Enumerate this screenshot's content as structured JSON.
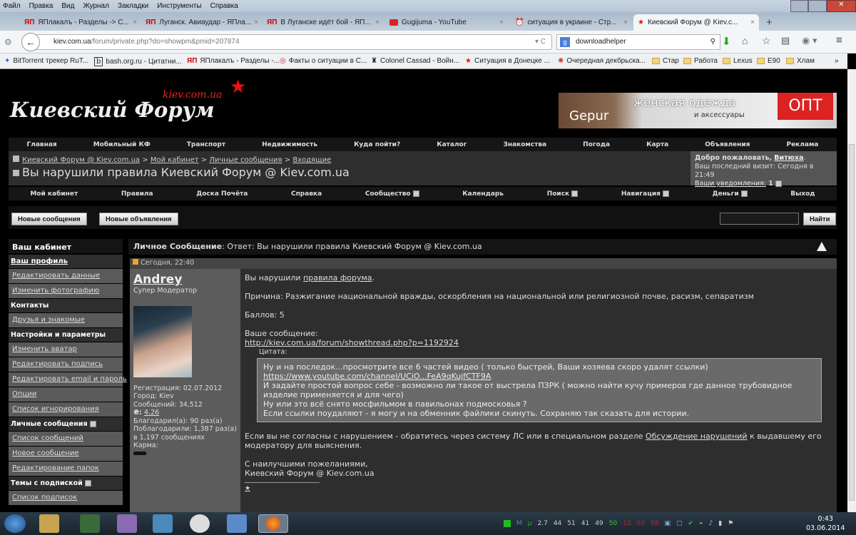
{
  "browser": {
    "menu": [
      "Файл",
      "Правка",
      "Вид",
      "Журнал",
      "Закладки",
      "Инструменты",
      "Справка"
    ],
    "tabs": [
      {
        "label": "ЯПлакалъ - Разделы -> С...",
        "icon": "yaplakal-icon"
      },
      {
        "label": "Луганск. Авиаудар - ЯПла...",
        "icon": "yaplakal-icon"
      },
      {
        "label": "В Луганске идёт бой - ЯП...",
        "icon": "yaplakal-icon"
      },
      {
        "label": "Gugijuma - YouTube",
        "icon": "youtube-icon"
      },
      {
        "label": "ситуация в украине - Стр...",
        "icon": "alarm-icon"
      },
      {
        "label": "Киевский Форум @ Kiev.c...",
        "icon": "star-icon",
        "active": true
      }
    ],
    "url_host": "kiev.com.ua",
    "url_path": "/forum/private.php?do=showpm&pmid=207874",
    "search_value": "downloadhelper",
    "bookmarks": [
      "BitTorrent трекер RuT...",
      "bash.org.ru - Цитатни...",
      "ЯПлакалъ - Разделы -...",
      "Факты о ситуации в С...",
      "Colonel Cassad - Войн...",
      "Ситуация в Донецке ...",
      "Очередная декбрьска..."
    ],
    "bookmark_folders": [
      "Стар",
      "Работа",
      "Lexus",
      "E90",
      "Хлам"
    ]
  },
  "site": {
    "logo": "Киевский Форум",
    "logo_sub": "kiev.com.ua",
    "banner": {
      "brand": "Gepur",
      "line1": "женская одежда",
      "line2": "и аксессуары",
      "badge": "ОПТ"
    },
    "topnav": [
      "Главная",
      "Мобильный КФ",
      "Транспорт",
      "Недвижимость",
      "Куда пойти?",
      "Каталог",
      "Знакомства",
      "Погода",
      "Карта",
      "Объявления",
      "Реклама"
    ],
    "breadcrumb": [
      "Киевский Форум @ Kiev.com.ua",
      "Мой кабинет",
      "Личные сообщения",
      "Входящие"
    ],
    "page_title": "Вы нарушили правила Киевский Форум @ Kiev.com.ua",
    "welcome": {
      "greeting": "Добро пожаловать,",
      "user": "Витюха",
      "last_visit": "Ваш последний визит: Сегодня в 21:49",
      "notifications_label": "Ваши уведомления:",
      "notifications_count": "1"
    },
    "subnav": [
      "Мой кабинет",
      "Правила",
      "Доска Почёта",
      "Справка",
      "Сообщество",
      "Календарь",
      "Поиск",
      "Навигация",
      "Деньги",
      "Выход"
    ],
    "btn_new_posts": "Новые сообщения",
    "btn_new_ads": "Новые объявления",
    "search_button": "Найти"
  },
  "sidebar": {
    "title": "Ваш кабинет",
    "items": [
      {
        "label": "Ваш профиль",
        "type": "bold"
      },
      {
        "label": "Редактировать данные",
        "type": "link"
      },
      {
        "label": "Изменить фотографию",
        "type": "link"
      },
      {
        "label": "Контакты",
        "type": "section"
      },
      {
        "label": "Друзья и знакомые",
        "type": "link"
      },
      {
        "label": "Настройки и параметры",
        "type": "section"
      },
      {
        "label": "Изменить аватар",
        "type": "link"
      },
      {
        "label": "Редактировать подпись",
        "type": "link"
      },
      {
        "label": "Редактировать email и пароль",
        "type": "link"
      },
      {
        "label": "Опции",
        "type": "link"
      },
      {
        "label": "Список игнорирования",
        "type": "link"
      },
      {
        "label": "Личные сообщения",
        "type": "section"
      },
      {
        "label": "Список сообщений",
        "type": "link"
      },
      {
        "label": "Новое сообщение",
        "type": "link"
      },
      {
        "label": "Редактирование папок",
        "type": "link"
      },
      {
        "label": "Темы с подпиской",
        "type": "section"
      },
      {
        "label": "Список подписок",
        "type": "link"
      }
    ]
  },
  "message": {
    "header_label": "Личное Сообщение",
    "header_title": "Ответ: Вы нарушили правила Киевский Форум @ Kiev.com.ua",
    "date": "Сегодня, 22:40",
    "author": {
      "name": "Andrey",
      "role": "Супер Модератор",
      "registration": "Регистрация: 02.07.2012",
      "city": "Город: Kiev",
      "posts": "Сообщений: 34,512",
      "rating_label": "₴:",
      "rating": "4.26",
      "thanked": "Благодарил(а): 90 раз(а)",
      "thanked_by": "Поблагодарили: 1,387 раз(а)",
      "in_posts": "в 1,197 сообщениях",
      "karma": "Карма:"
    },
    "intro": "Вы нарушили",
    "rules_link": "правила форума",
    "reason": "Причина: Разжигание национальной вражды, оскорбления на национальной или религиозной почве, расизм, сепаратизм",
    "points": "Баллов: 5",
    "your_post": "Ваше сообщение:",
    "post_link": "http://kiev.com.ua/forum/showthread.php?p=1192924",
    "quote_label": "Цитата:",
    "quote_lines": [
      "Ну и на последок...просмотрите все 6 частей видео ( только быстрей, Ваши хозяева скоро удалят ссылки)",
      "https://www.youtube.com/channel/UCiO...FeA9qKujfCTF9A",
      "И задайте простой вопрос себе - возможно ли такое от выстрела ПЗРК ( можно найти кучу примеров где данное трубовидное изделие применяется и для чего)",
      "Ну или это всё снято мосфильмом в павильонах подмосковья ?",
      "Если ссылки поудаляют - я могу и на обменник файлики скинуть. Сохраняю так сказать для истории."
    ],
    "appeal_before": "Если вы не согласны с нарушением - обратитесь через систему ЛС или в специальном разделе",
    "appeal_link": "Обсуждение нарушений",
    "appeal_after": "к выдавшему его модератору для выяснения.",
    "regards": "С наилучшими пожеланиями,",
    "signature": "Киевский Форум @ Kiev.com.ua"
  },
  "taskbar": {
    "tray_numbers": [
      "2.7",
      "44",
      "51",
      "41",
      "49",
      "50",
      "13",
      "02",
      "08"
    ],
    "time": "0:43",
    "date": "03.06.2014"
  }
}
